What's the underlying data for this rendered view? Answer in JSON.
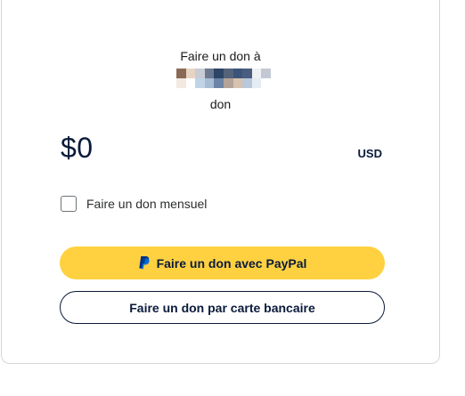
{
  "donation": {
    "to_label": "Faire un don à",
    "subtitle": "don",
    "amount": "$0",
    "currency": "USD",
    "monthly_label": "Faire un don mensuel",
    "monthly_checked": false
  },
  "buttons": {
    "paypal_label": "Faire un don avec PayPal",
    "card_label": "Faire un don par carte bancaire"
  },
  "icons": {
    "paypal": "paypal-icon"
  },
  "colors": {
    "paypal_button": "#ffd140",
    "text_primary": "#0a1a3a",
    "card_border": "#d6d6d6"
  }
}
